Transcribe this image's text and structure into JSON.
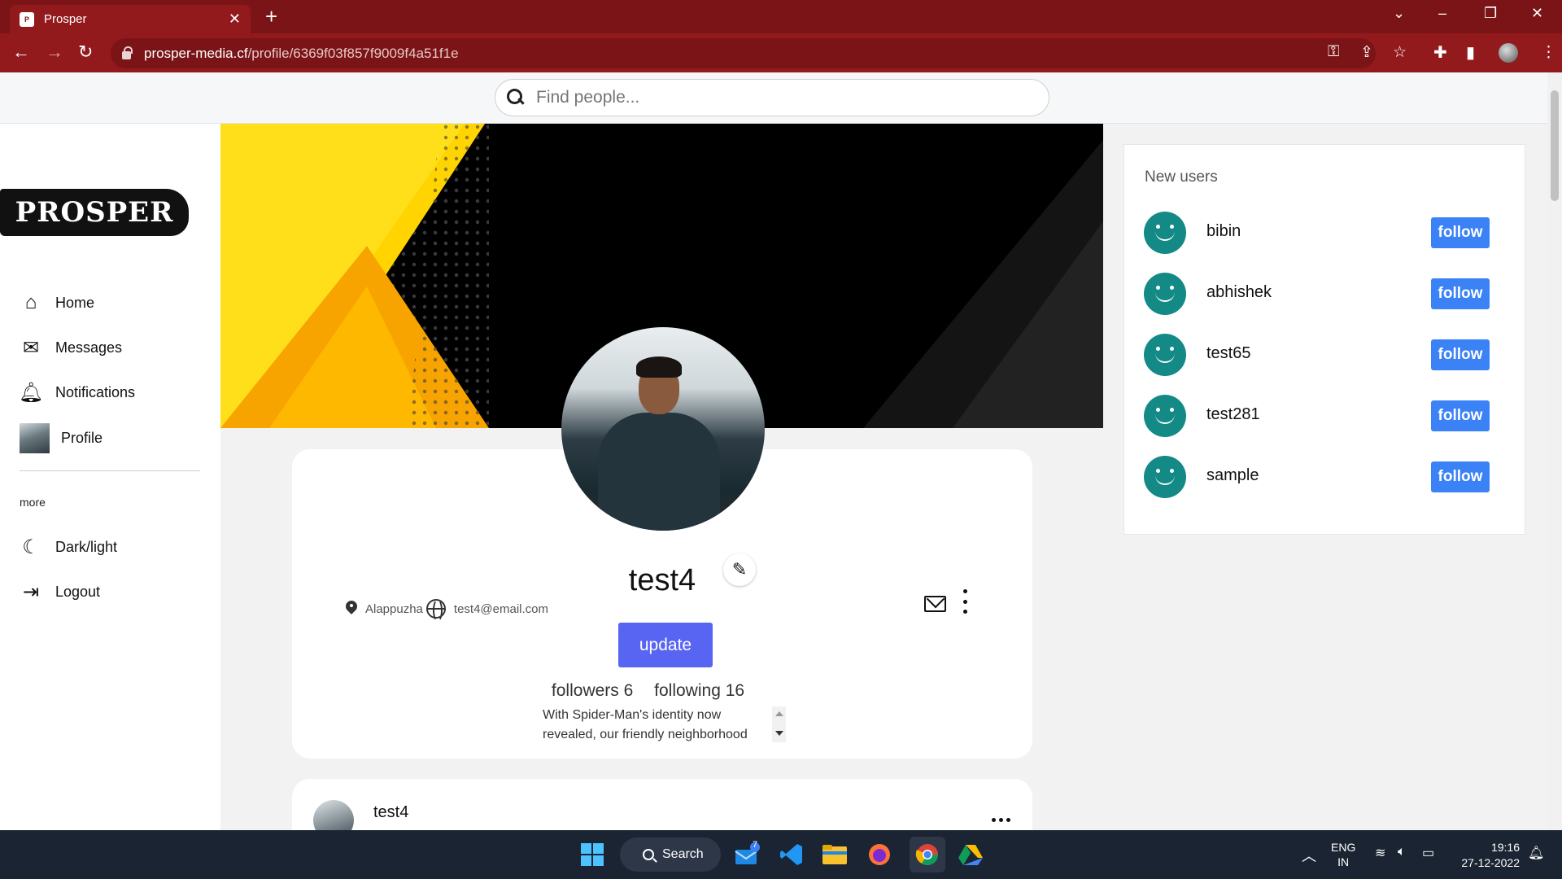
{
  "browser": {
    "tab_title": "Prosper",
    "tab_favicon": "P",
    "url_host": "prosper-media.cf",
    "url_path": "/profile/6369f03f857f9009f4a51f1e"
  },
  "search": {
    "placeholder": "Find people..."
  },
  "sidebar": {
    "logo": "PROSPER",
    "items": [
      {
        "label": "Home",
        "icon": "home-icon"
      },
      {
        "label": "Messages",
        "icon": "mail-icon"
      },
      {
        "label": "Notifications",
        "icon": "bell-icon"
      },
      {
        "label": "Profile",
        "icon": "profile-avatar"
      }
    ],
    "more_label": "more",
    "more_items": [
      {
        "label": "Dark/light",
        "icon": "moon-icon"
      },
      {
        "label": "Logout",
        "icon": "logout-icon"
      }
    ]
  },
  "profile": {
    "username": "test4",
    "location": "Alappuzha",
    "email": "test4@email.com",
    "update_label": "update",
    "followers_text": "followers 6",
    "following_text": "following 16",
    "bio": "With Spider-Man's identity now revealed, our friendly neighborhood"
  },
  "post": {
    "username": "test4"
  },
  "new_users": {
    "title": "New users",
    "follow_label": "follow",
    "users": [
      "bibin",
      "abhishek",
      "test65",
      "test281",
      "sample"
    ]
  },
  "taskbar": {
    "search_label": "Search",
    "mail_badge": "7",
    "lang_top": "ENG",
    "lang_bottom": "IN",
    "time": "19:16",
    "date": "27-12-2022"
  },
  "colors": {
    "chrome_dark": "#7a1416",
    "chrome_tab": "#931a1c",
    "accent_update": "#5865f2",
    "accent_follow": "#3b82f6",
    "avatar_teal": "#138a86",
    "cover_yellow": "#ffd400"
  }
}
